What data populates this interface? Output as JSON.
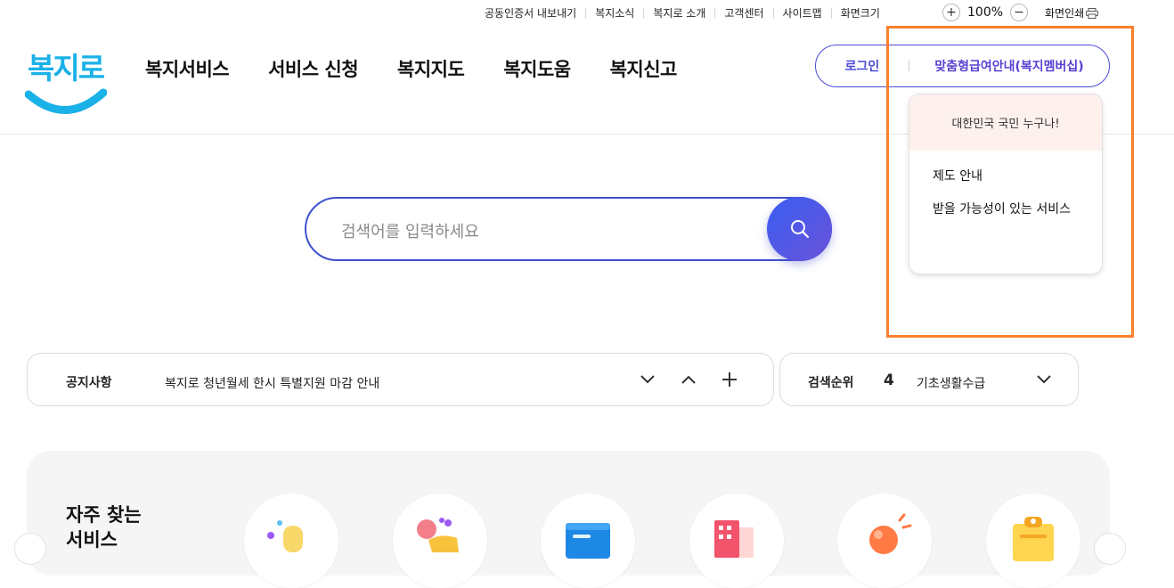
{
  "utility": {
    "links": [
      "공동인증서 내보내기",
      "복지소식",
      "복지로 소개",
      "고객센터",
      "사이트맵",
      "화면크기"
    ],
    "zoom_in": "+",
    "zoom_level": "100%",
    "zoom_out": "−",
    "print_label": "화면인쇄"
  },
  "logo": {
    "text": "복지로"
  },
  "nav": {
    "items": [
      "복지서비스",
      "서비스 신청",
      "복지지도",
      "복지도움",
      "복지신고"
    ]
  },
  "account": {
    "login": "로그인",
    "membership": "맞춤형급여안내(복지멤버십)"
  },
  "dropdown": {
    "header": "대한민국 국민 누구나!",
    "items": [
      "제도 안내",
      "받을 가능성이 있는 서비스"
    ]
  },
  "search": {
    "placeholder": "검색어를 입력하세요"
  },
  "notice": {
    "label": "공지사항",
    "text": "복지로 청년월세 한시 특별지원 마감 안내"
  },
  "ranking": {
    "label": "검색순위",
    "rank": "4",
    "keyword": "기초생활수급"
  },
  "frequent": {
    "title": "자주 찾는 서비스"
  },
  "colors": {
    "accent": "#4a4bd7",
    "highlight": "#fb7f2d",
    "logo_blue": "#1ab1e8"
  }
}
